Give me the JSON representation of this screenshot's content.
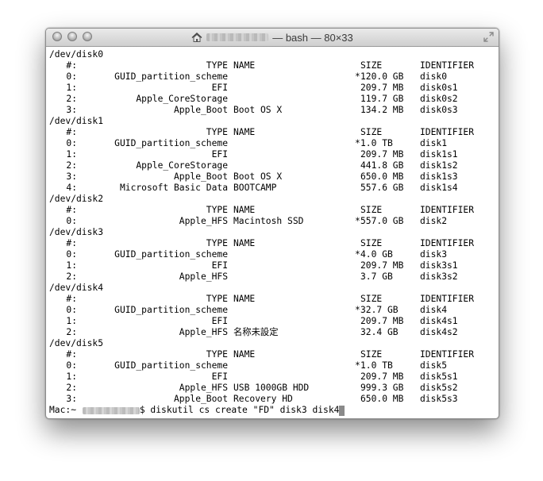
{
  "window": {
    "title_suffix": " — bash — 80×33"
  },
  "disks": [
    {
      "device": "/dev/disk0",
      "header": {
        "num": "#:",
        "type": "TYPE",
        "name": "NAME",
        "size": "SIZE",
        "id": "IDENTIFIER"
      },
      "rows": [
        {
          "num": "0:",
          "type": "GUID_partition_scheme",
          "name": "",
          "star": "*",
          "size": "120.0 GB",
          "id": "disk0"
        },
        {
          "num": "1:",
          "type": "EFI",
          "name": "",
          "star": "",
          "size": "209.7 MB",
          "id": "disk0s1"
        },
        {
          "num": "2:",
          "type": "Apple_CoreStorage",
          "name": "",
          "star": "",
          "size": "119.7 GB",
          "id": "disk0s2"
        },
        {
          "num": "3:",
          "type": "Apple_Boot",
          "name": "Boot OS X",
          "star": "",
          "size": "134.2 MB",
          "id": "disk0s3"
        }
      ]
    },
    {
      "device": "/dev/disk1",
      "header": {
        "num": "#:",
        "type": "TYPE",
        "name": "NAME",
        "size": "SIZE",
        "id": "IDENTIFIER"
      },
      "rows": [
        {
          "num": "0:",
          "type": "GUID_partition_scheme",
          "name": "",
          "star": "*",
          "size": "1.0 TB",
          "id": "disk1"
        },
        {
          "num": "1:",
          "type": "EFI",
          "name": "",
          "star": "",
          "size": "209.7 MB",
          "id": "disk1s1"
        },
        {
          "num": "2:",
          "type": "Apple_CoreStorage",
          "name": "",
          "star": "",
          "size": "441.8 GB",
          "id": "disk1s2"
        },
        {
          "num": "3:",
          "type": "Apple_Boot",
          "name": "Boot OS X",
          "star": "",
          "size": "650.0 MB",
          "id": "disk1s3"
        },
        {
          "num": "4:",
          "type": "Microsoft Basic Data",
          "name": "BOOTCAMP",
          "star": "",
          "size": "557.6 GB",
          "id": "disk1s4"
        }
      ]
    },
    {
      "device": "/dev/disk2",
      "header": {
        "num": "#:",
        "type": "TYPE",
        "name": "NAME",
        "size": "SIZE",
        "id": "IDENTIFIER"
      },
      "rows": [
        {
          "num": "0:",
          "type": "Apple_HFS",
          "name": "Macintosh SSD",
          "star": "*",
          "size": "557.0 GB",
          "id": "disk2"
        }
      ]
    },
    {
      "device": "/dev/disk3",
      "header": {
        "num": "#:",
        "type": "TYPE",
        "name": "NAME",
        "size": "SIZE",
        "id": "IDENTIFIER"
      },
      "rows": [
        {
          "num": "0:",
          "type": "GUID_partition_scheme",
          "name": "",
          "star": "*",
          "size": "4.0 GB",
          "id": "disk3"
        },
        {
          "num": "1:",
          "type": "EFI",
          "name": "",
          "star": "",
          "size": "209.7 MB",
          "id": "disk3s1"
        },
        {
          "num": "2:",
          "type": "Apple_HFS",
          "name": "",
          "star": "",
          "size": "3.7 GB",
          "id": "disk3s2"
        }
      ]
    },
    {
      "device": "/dev/disk4",
      "header": {
        "num": "#:",
        "type": "TYPE",
        "name": "NAME",
        "size": "SIZE",
        "id": "IDENTIFIER"
      },
      "rows": [
        {
          "num": "0:",
          "type": "GUID_partition_scheme",
          "name": "",
          "star": "*",
          "size": "32.7 GB",
          "id": "disk4"
        },
        {
          "num": "1:",
          "type": "EFI",
          "name": "",
          "star": "",
          "size": "209.7 MB",
          "id": "disk4s1"
        },
        {
          "num": "2:",
          "type": "Apple_HFS",
          "name": "名称未設定",
          "star": "",
          "size": "32.4 GB",
          "id": "disk4s2"
        }
      ]
    },
    {
      "device": "/dev/disk5",
      "header": {
        "num": "#:",
        "type": "TYPE",
        "name": "NAME",
        "size": "SIZE",
        "id": "IDENTIFIER"
      },
      "rows": [
        {
          "num": "0:",
          "type": "GUID_partition_scheme",
          "name": "",
          "star": "*",
          "size": "1.0 TB",
          "id": "disk5"
        },
        {
          "num": "1:",
          "type": "EFI",
          "name": "",
          "star": "",
          "size": "209.7 MB",
          "id": "disk5s1"
        },
        {
          "num": "2:",
          "type": "Apple_HFS",
          "name": "USB 1000GB HDD",
          "star": "",
          "size": "999.3 GB",
          "id": "disk5s2"
        },
        {
          "num": "3:",
          "type": "Apple_Boot",
          "name": "Recovery HD",
          "star": "",
          "size": "650.0 MB",
          "id": "disk5s3"
        }
      ]
    }
  ],
  "prompt": {
    "host": "Mac:~ ",
    "command": "$ diskutil cs create \"FD\" disk3 disk4"
  }
}
